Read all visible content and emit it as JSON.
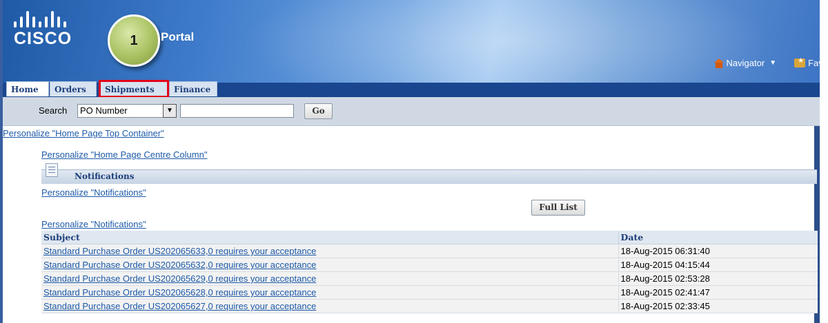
{
  "header": {
    "logo_text": "CISCO",
    "step_number": "1",
    "portal_title": "Portal",
    "navigator_label": "Navigator",
    "favorites_label": "Favo"
  },
  "tabs": [
    {
      "label": "Home",
      "active": true,
      "highlighted": false
    },
    {
      "label": "Orders",
      "active": false,
      "highlighted": false
    },
    {
      "label": "Shipments",
      "active": false,
      "highlighted": true
    },
    {
      "label": "Finance",
      "active": false,
      "highlighted": false
    }
  ],
  "search": {
    "label": "Search",
    "selected_option": "PO Number",
    "input_value": "",
    "go_label": "Go"
  },
  "personalize": {
    "top_container": "Personalize \"Home Page Top Container\"",
    "centre_column": "Personalize \"Home Page Centre Column\"",
    "notifications_1": "Personalize \"Notifications\"",
    "notifications_2": "Personalize \"Notifications\""
  },
  "notifications": {
    "title": "Notifications",
    "full_list_label": "Full List",
    "columns": [
      "Subject",
      "Date"
    ],
    "rows": [
      {
        "subject": "Standard Purchase Order US202065633,0 requires your acceptance",
        "date": "18-Aug-2015 06:31:40"
      },
      {
        "subject": "Standard Purchase Order US202065632,0 requires your acceptance",
        "date": "18-Aug-2015 04:15:44"
      },
      {
        "subject": "Standard Purchase Order US202065629,0 requires your acceptance",
        "date": "18-Aug-2015 02:53:28"
      },
      {
        "subject": "Standard Purchase Order US202065628,0 requires your acceptance",
        "date": "18-Aug-2015 02:41:47"
      },
      {
        "subject": "Standard Purchase Order US202065627,0 requires your acceptance",
        "date": "18-Aug-2015 02:33:45"
      }
    ]
  },
  "colors": {
    "banner": "#1f5aa6",
    "tab_bar": "#1a468f",
    "link": "#1d5aa8",
    "highlight": "#e3051b",
    "step_badge": "#a9c262"
  }
}
